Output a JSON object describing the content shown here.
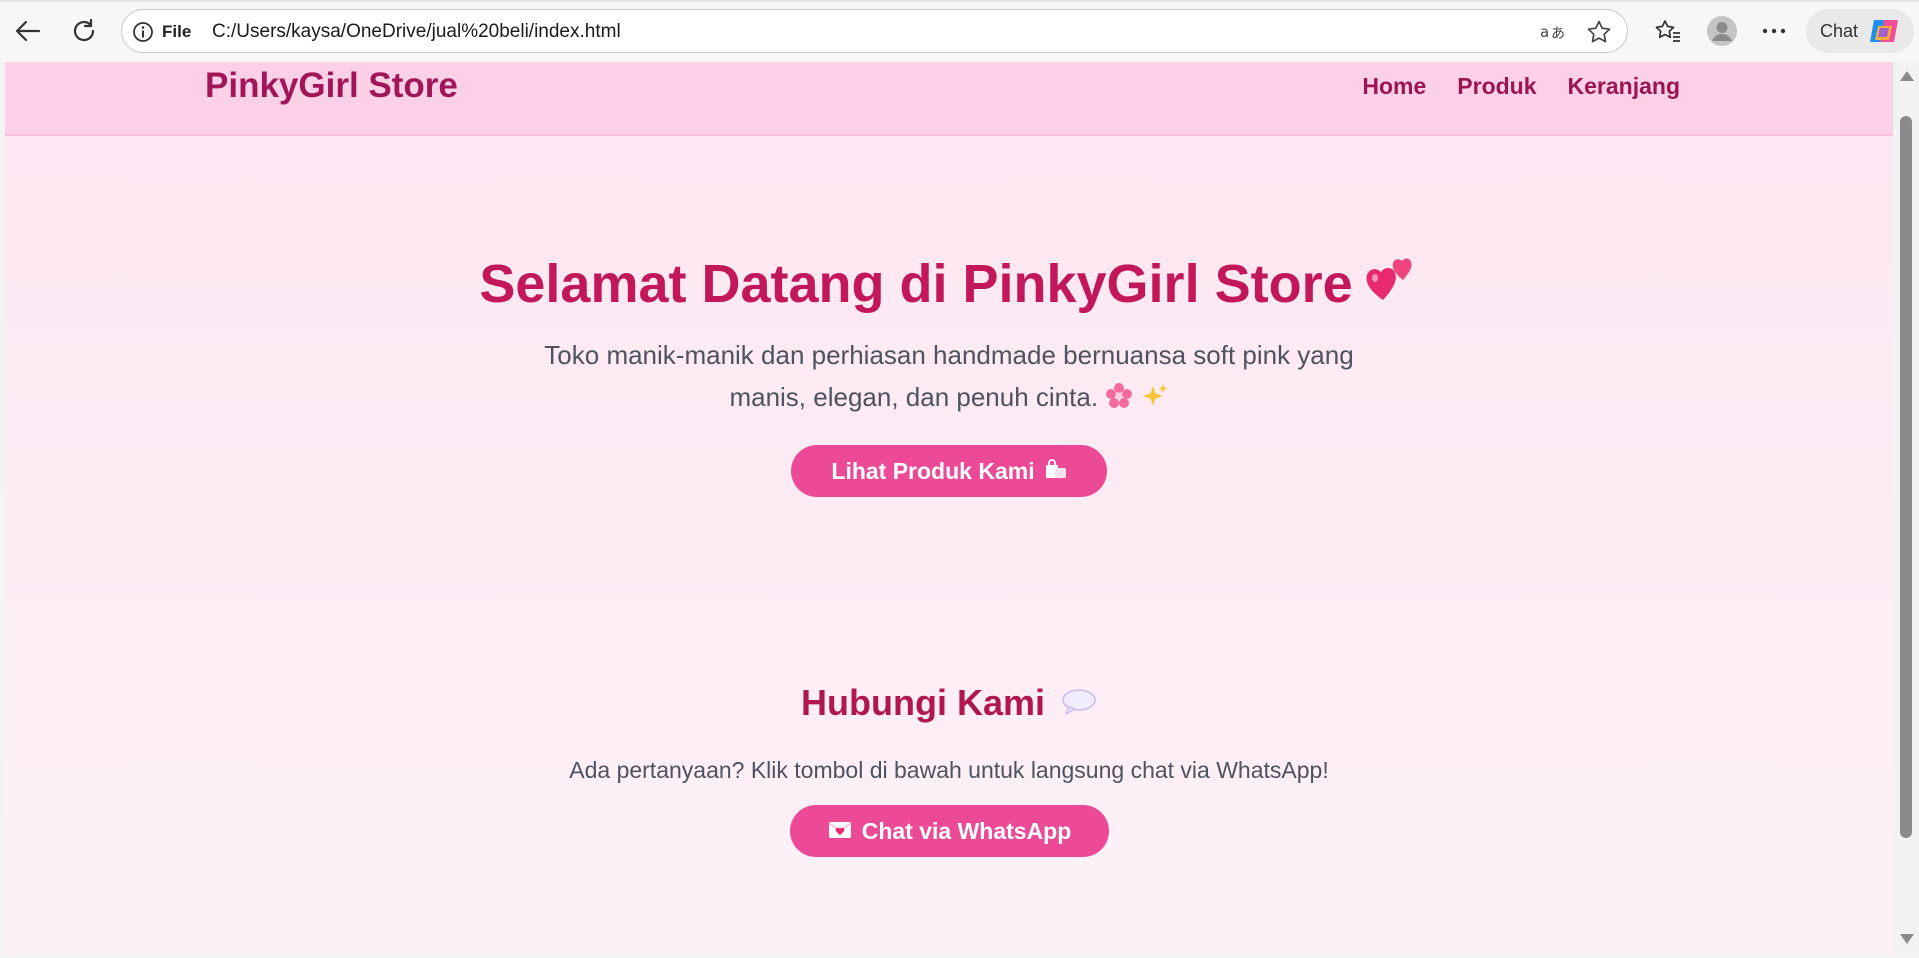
{
  "browser": {
    "scheme_label": "File",
    "url": "C:/Users/kaysa/OneDrive/jual%20beli/index.html",
    "chat_label": "Chat",
    "icons": [
      "back-icon",
      "refresh-icon",
      "info-icon",
      "read-aloud-icon",
      "favorite-star-icon",
      "favorites-icon",
      "profile-icon",
      "more-icon",
      "copilot-icon"
    ]
  },
  "site": {
    "brand": "PinkyGirl Store",
    "nav": [
      "Home",
      "Produk",
      "Keranjang"
    ],
    "hero": {
      "title": "Selamat Datang di PinkyGirl Store",
      "text": "Toko manik-manik dan perhiasan handmade bernuansa soft pink yang manis, elegan, dan penuh cinta.",
      "button": "Lihat Produk Kami"
    },
    "contact": {
      "title": "Hubungi Kami",
      "text": "Ada pertanyaan? Klik tombol di bawah untuk langsung chat via WhatsApp!",
      "button": "Chat via WhatsApp"
    }
  },
  "colors": {
    "header_bg": "#fcd0e6",
    "brand": "#a01659",
    "heading": "#c2185b",
    "button": "#ec4a96",
    "body_text": "#4d5360"
  }
}
